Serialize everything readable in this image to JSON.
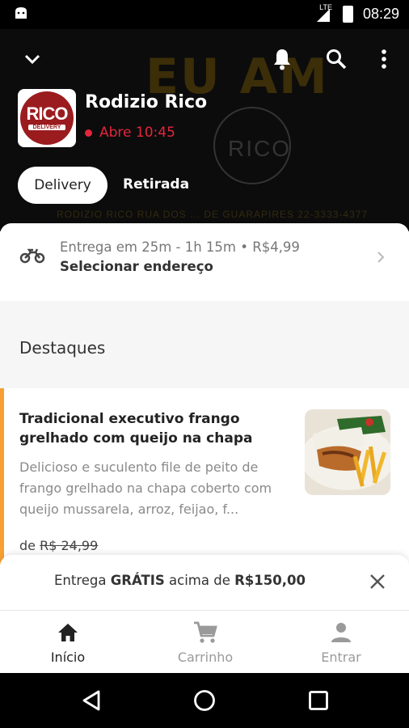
{
  "status_bar": {
    "time": "08:29",
    "network": "LTE"
  },
  "hero": {
    "background_text": "EU AM",
    "background_logo_text": "RICO",
    "background_strip": "RODIZIO RICO   RUA DOS ... DE GUARAPIRES   22-3333-4377"
  },
  "toolbar": {
    "icons": [
      "chevron-down-icon",
      "bell-icon",
      "search-icon",
      "more-vert-icon"
    ]
  },
  "store": {
    "logo_main": "RICO",
    "logo_sub": "DELIVERY",
    "name": "Rodizio Rico",
    "status": "Abre 10:45",
    "status_color": "#e3263c"
  },
  "mode_tabs": {
    "delivery": "Delivery",
    "pickup": "Retirada"
  },
  "delivery_info": {
    "line1": "Entrega em 25m - 1h 15m • R$4,99",
    "line2": "Selecionar endereço"
  },
  "highlights": {
    "title": "Destaques",
    "product": {
      "title": "Tradicional executivo frango grelhado com queijo na chapa",
      "description": "Delicioso e suculento file de peito de frango grelhado na chapa coberto com queijo mussarela, arroz, feijao, f...",
      "price_prefix": "de",
      "price_old": "R$ 24,99",
      "accent_color": "#f6a031"
    }
  },
  "free_delivery_banner": {
    "prefix": "Entrega ",
    "bold": "GRÁTIS",
    "suffix": " acima de ",
    "amount": "R$150,00"
  },
  "bottom_nav": [
    {
      "label": "Início",
      "icon": "home-icon",
      "active": true
    },
    {
      "label": "Carrinho",
      "icon": "cart-icon",
      "active": false
    },
    {
      "label": "Entrar",
      "icon": "person-icon",
      "active": false
    }
  ],
  "colors": {
    "accent": "#f6a031",
    "open_status": "#e3263c",
    "active_nav": "#222222",
    "inactive_nav": "#9a9a9a"
  }
}
